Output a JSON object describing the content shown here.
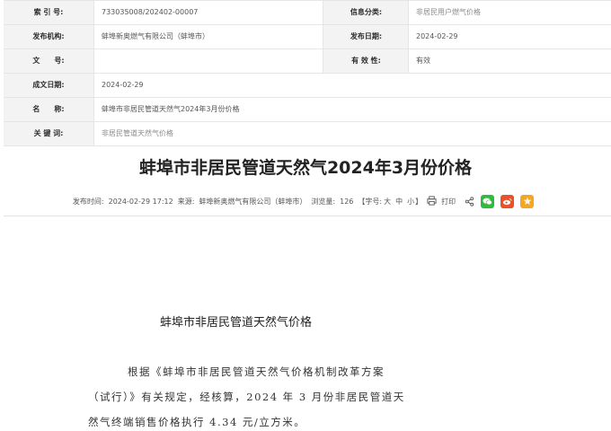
{
  "meta": {
    "index_label": "索 引 号:",
    "index_value": "733035008/202402-00007",
    "category_label": "信息分类:",
    "category_value": "非居民用户燃气价格",
    "publisher_label": "发布机构:",
    "publisher_value": "蚌埠新奥燃气有限公司（蚌埠市）",
    "pubdate_label": "发布日期:",
    "pubdate_value": "2024-02-29",
    "docno_label": "文　　号:",
    "docno_value": "",
    "validity_label": "有 效 性:",
    "validity_value": "有效",
    "created_label": "成文日期:",
    "created_value": "2024-02-29",
    "name_label": "名　　称:",
    "name_value": "蚌埠市非居民管道天然气2024年3月份价格",
    "keywords_label": "关 键 词:",
    "keywords_value": "非居民管道天然气价格"
  },
  "article": {
    "title": "蚌埠市非居民管道天然气2024年3月份价格",
    "info": {
      "time_label": "发布时间:",
      "time_value": "2024-02-29 17:12",
      "source_label": "来源:",
      "source_value": "蚌埠新奥燃气有限公司（蚌埠市）",
      "views_label": "浏览量:",
      "views_value": "126",
      "font_open": "【字号:",
      "font_big": "大",
      "font_mid": "中",
      "font_small": "小",
      "font_close": "】",
      "print_label": "打印"
    },
    "subtitle": "蚌埠市非居民管道天然气价格",
    "para_lines": [
      "根据《蚌埠市非居民管道天然气价格机制改革方案",
      "（试行）》有关规定，经核算，2024 年 3 月份非居民管道天",
      "然气终端销售价格执行 4.34 元/立方米。"
    ]
  },
  "icons": [
    "printer-icon",
    "share-icon",
    "wechat-icon",
    "weibo-icon",
    "favorite-icon"
  ],
  "colors": {
    "wechat": "#2dbd3a",
    "weibo": "#e8522b",
    "favorite": "#f5a623"
  }
}
